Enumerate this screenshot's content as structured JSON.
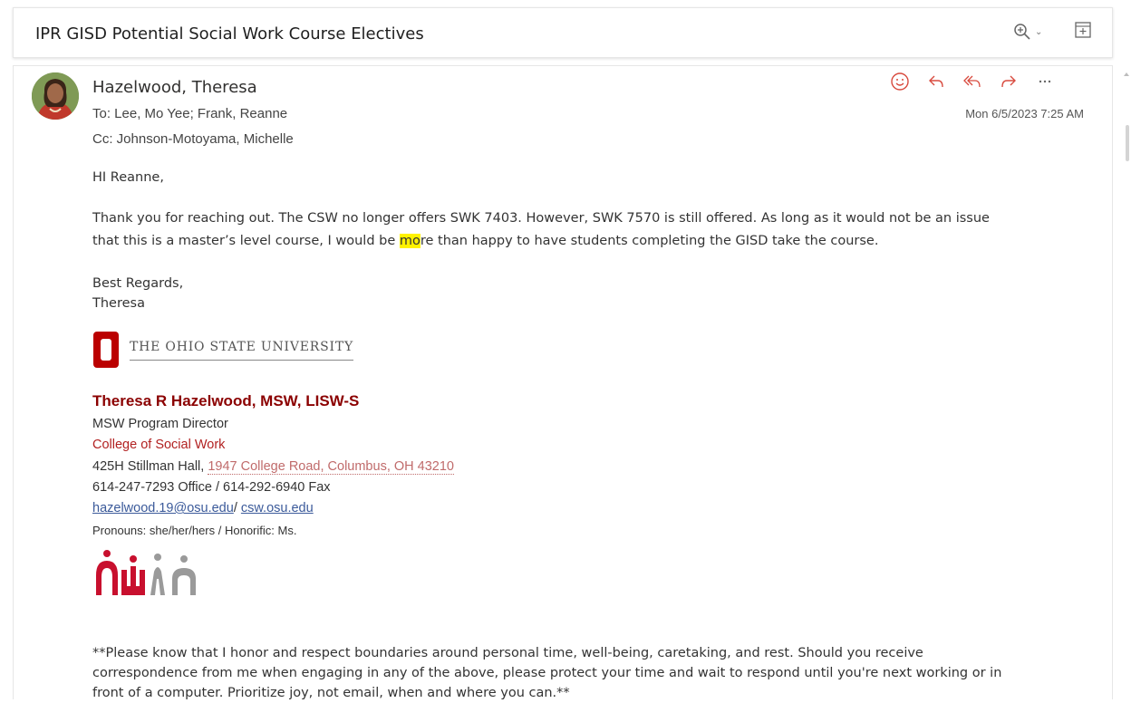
{
  "subject": "IPR GISD Potential Social Work Course Electives",
  "sender": {
    "name": "Hazelwood, Theresa"
  },
  "to_line": "To: Lee, Mo Yee;  Frank, Reanne",
  "cc_line": "Cc: Johnson-Motoyama, Michelle",
  "date": "Mon 6/5/2023 7:25 AM",
  "icons": [
    "zoom-icon",
    "popout-icon",
    "emoji-icon",
    "reply-icon",
    "reply-all-icon",
    "forward-icon",
    "more-icon"
  ],
  "body": {
    "greeting": "HI Reanne,",
    "para1_line1": "Thank you for reaching out. The CSW no longer offers SWK 7403. However,  SWK 7570 is still offered. As long as it would not be an issue",
    "para1_line2_before": "that this is a master’s level course, I would be ",
    "para1_line2_highlight": "mo",
    "para1_line2_after": "re than happy to have students completing the GISD take the course.",
    "closing": "Best Regards,",
    "closing_name": "Theresa"
  },
  "signature": {
    "university": "THE OHIO STATE UNIVERSITY",
    "name": "Theresa R Hazelwood, MSW, LISW-S",
    "title": "MSW Program Director",
    "college": "College of Social Work",
    "address_prefix": "425H Stillman Hall, ",
    "address_link": "1947 College Road, Columbus, OH 43210",
    "phone": "614-247-7293 Office / 614-292-6940 Fax",
    "email": "hazelwood.19@osu.edu",
    "email_sep": "/ ",
    "website": "csw.osu.edu",
    "pronouns": "Pronouns: she/her/hers / Honorific: Ms."
  },
  "footer": {
    "line1": "**Please know that I honor and respect boundaries around personal time, well-being, caretaking, and rest. Should you receive",
    "line2": "correspondence from me when engaging in any of the above, please protect your time and wait to respond until you're next working or in",
    "line3": "front of a computer. Prioritize joy, not email, when and where you can.**"
  },
  "colors": {
    "osu_red": "#bb0000",
    "sig_red": "#8b0000",
    "highlight": "#fff200",
    "action_icon": "#d84a3e"
  }
}
